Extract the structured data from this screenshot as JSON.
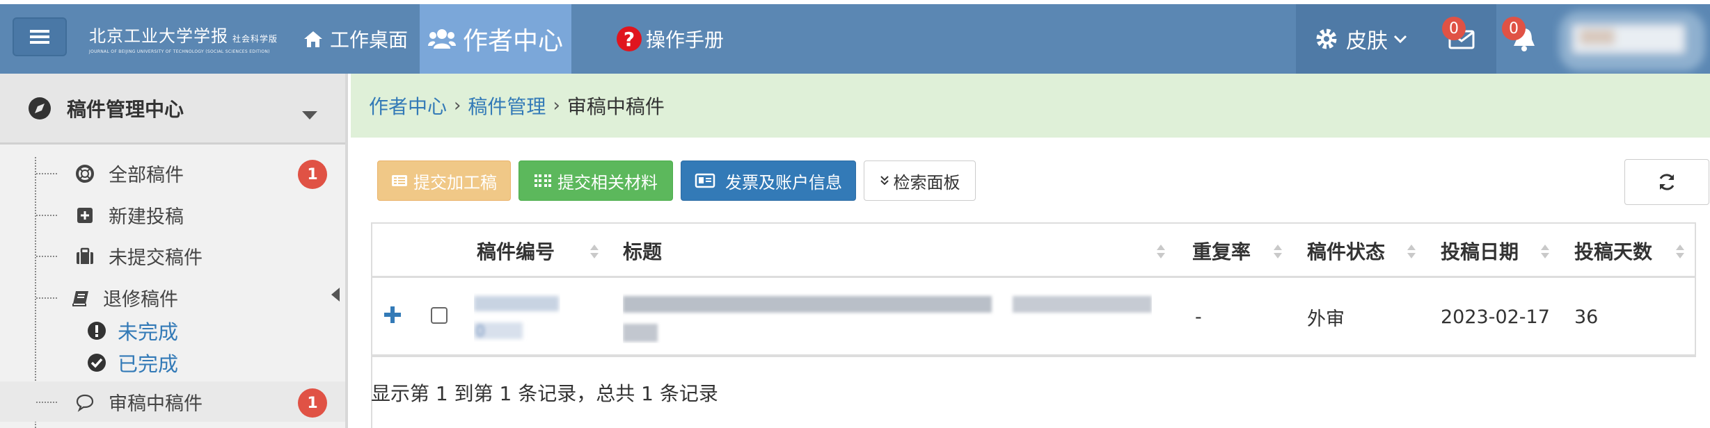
{
  "header": {
    "logo_cn": "北京工业大学学报",
    "logo_cn_sub": "社会科学版",
    "logo_en": "JOURNAL OF BEIJING UNIVERSITY OF TECHNOLOGY (SOCIAL SCIENCES EDITION)",
    "nav": {
      "home": "工作桌面",
      "author_center": "作者中心",
      "manual": "操作手册"
    },
    "skin_label": "皮肤",
    "mail_count": "0",
    "notice_count": "0"
  },
  "sidebar": {
    "section_title": "稿件管理中心",
    "items": [
      {
        "label": "全部稿件",
        "badge": "1",
        "icon": "lifebuoy-icon"
      },
      {
        "label": "新建投稿",
        "icon": "plus-square-icon"
      },
      {
        "label": "未提交稿件",
        "icon": "briefcase-icon"
      },
      {
        "label": "退修稿件",
        "icon": "book-icon"
      },
      {
        "label": "审稿中稿件",
        "badge": "1",
        "icon": "comment-icon"
      }
    ],
    "sub_items": [
      {
        "label": "未完成",
        "icon": "exclamation-circle-icon"
      },
      {
        "label": "已完成",
        "icon": "check-circle-icon"
      }
    ]
  },
  "breadcrumb": {
    "level1": "作者中心",
    "level2": "稿件管理",
    "current": "审稿中稿件"
  },
  "toolbar": {
    "submit_fee": "提交加工稿",
    "submit_materials": "提交相关材料",
    "invoice_account": "发票及账户信息",
    "search_panel": "检索面板"
  },
  "table": {
    "headers": {
      "number": "稿件编号",
      "title": "标题",
      "repeat_rate": "重复率",
      "status": "稿件状态",
      "date": "投稿日期",
      "days": "投稿天数"
    },
    "rows": [
      {
        "repeat_rate": "-",
        "status": "外审",
        "date": "2023-02-17",
        "days": "36"
      }
    ],
    "summary": "显示第 1 到第 1 条记录，总共 1 条记录"
  },
  "colors": {
    "navbar": "#5b87b3",
    "nav_active": "#7ba7d9",
    "badge": "#e05245",
    "breadcrumb_bg": "#dff0d8",
    "link": "#337ab7"
  }
}
